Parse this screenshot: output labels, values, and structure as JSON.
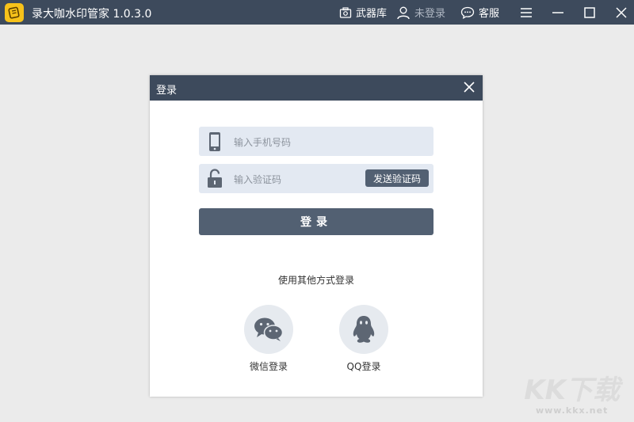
{
  "app": {
    "title": "录大咖水印管家  1.0.3.0"
  },
  "titlebar": {
    "arsenal_label": "武器库",
    "login_status": "未登录",
    "service_label": "客服"
  },
  "dialog": {
    "title": "登录",
    "phone_placeholder": "输入手机号码",
    "code_placeholder": "输入验证码",
    "send_code_label": "发送验证码",
    "login_label": "登录",
    "other_methods_label": "使用其他方式登录",
    "wechat_label": "微信登录",
    "qq_label": "QQ登录"
  },
  "colors": {
    "header_bg": "#3d4a5c",
    "button_bg": "#526072",
    "field_bg": "#e3e9f2",
    "logo_yellow": "#f7c21a"
  },
  "icons": [
    "logo-icon",
    "arsenal-icon",
    "user-icon",
    "chat-icon",
    "menu-icon",
    "minimize-icon",
    "maximize-icon",
    "close-icon",
    "phone-icon",
    "lock-icon",
    "wechat-icon",
    "qq-icon"
  ]
}
